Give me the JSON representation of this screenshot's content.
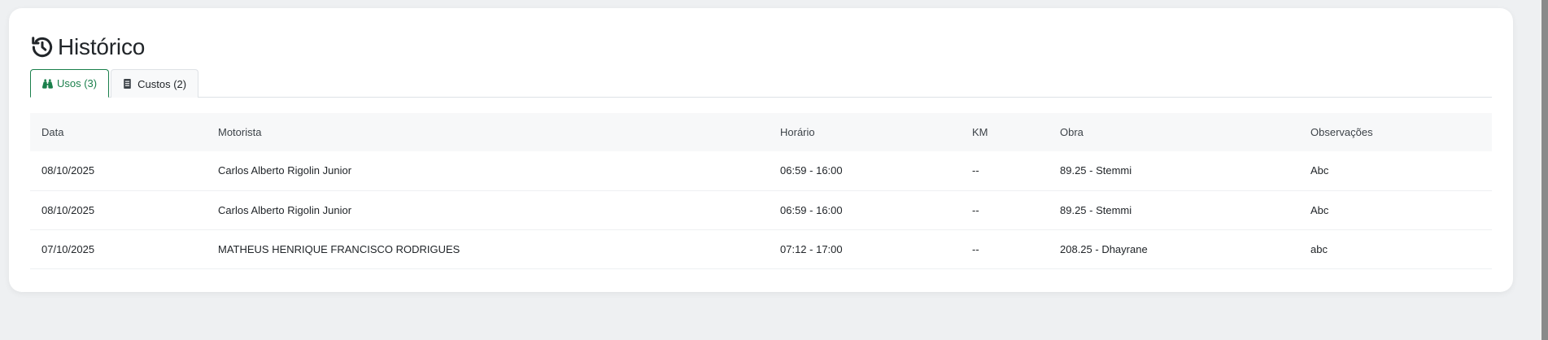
{
  "page": {
    "title": "Histórico",
    "accent_color": "#1a7f4b"
  },
  "tabs": [
    {
      "label": "Usos (3)",
      "icon": "binoculars-icon",
      "active": true
    },
    {
      "label": "Custos (2)",
      "icon": "receipt-icon",
      "active": false
    }
  ],
  "table": {
    "headers": [
      "Data",
      "Motorista",
      "Horário",
      "KM",
      "Obra",
      "Observações"
    ],
    "rows": [
      [
        "08/10/2025",
        "Carlos Alberto Rigolin Junior",
        "06:59 - 16:00",
        "--",
        "89.25 - Stemmi",
        "Abc"
      ],
      [
        "08/10/2025",
        "Carlos Alberto Rigolin Junior",
        "06:59 - 16:00",
        "--",
        "89.25 - Stemmi",
        "Abc"
      ],
      [
        "07/10/2025",
        "MATHEUS HENRIQUE FRANCISCO RODRIGUES",
        "07:12 - 17:00",
        "--",
        "208.25 - Dhayrane",
        "abc"
      ]
    ]
  }
}
